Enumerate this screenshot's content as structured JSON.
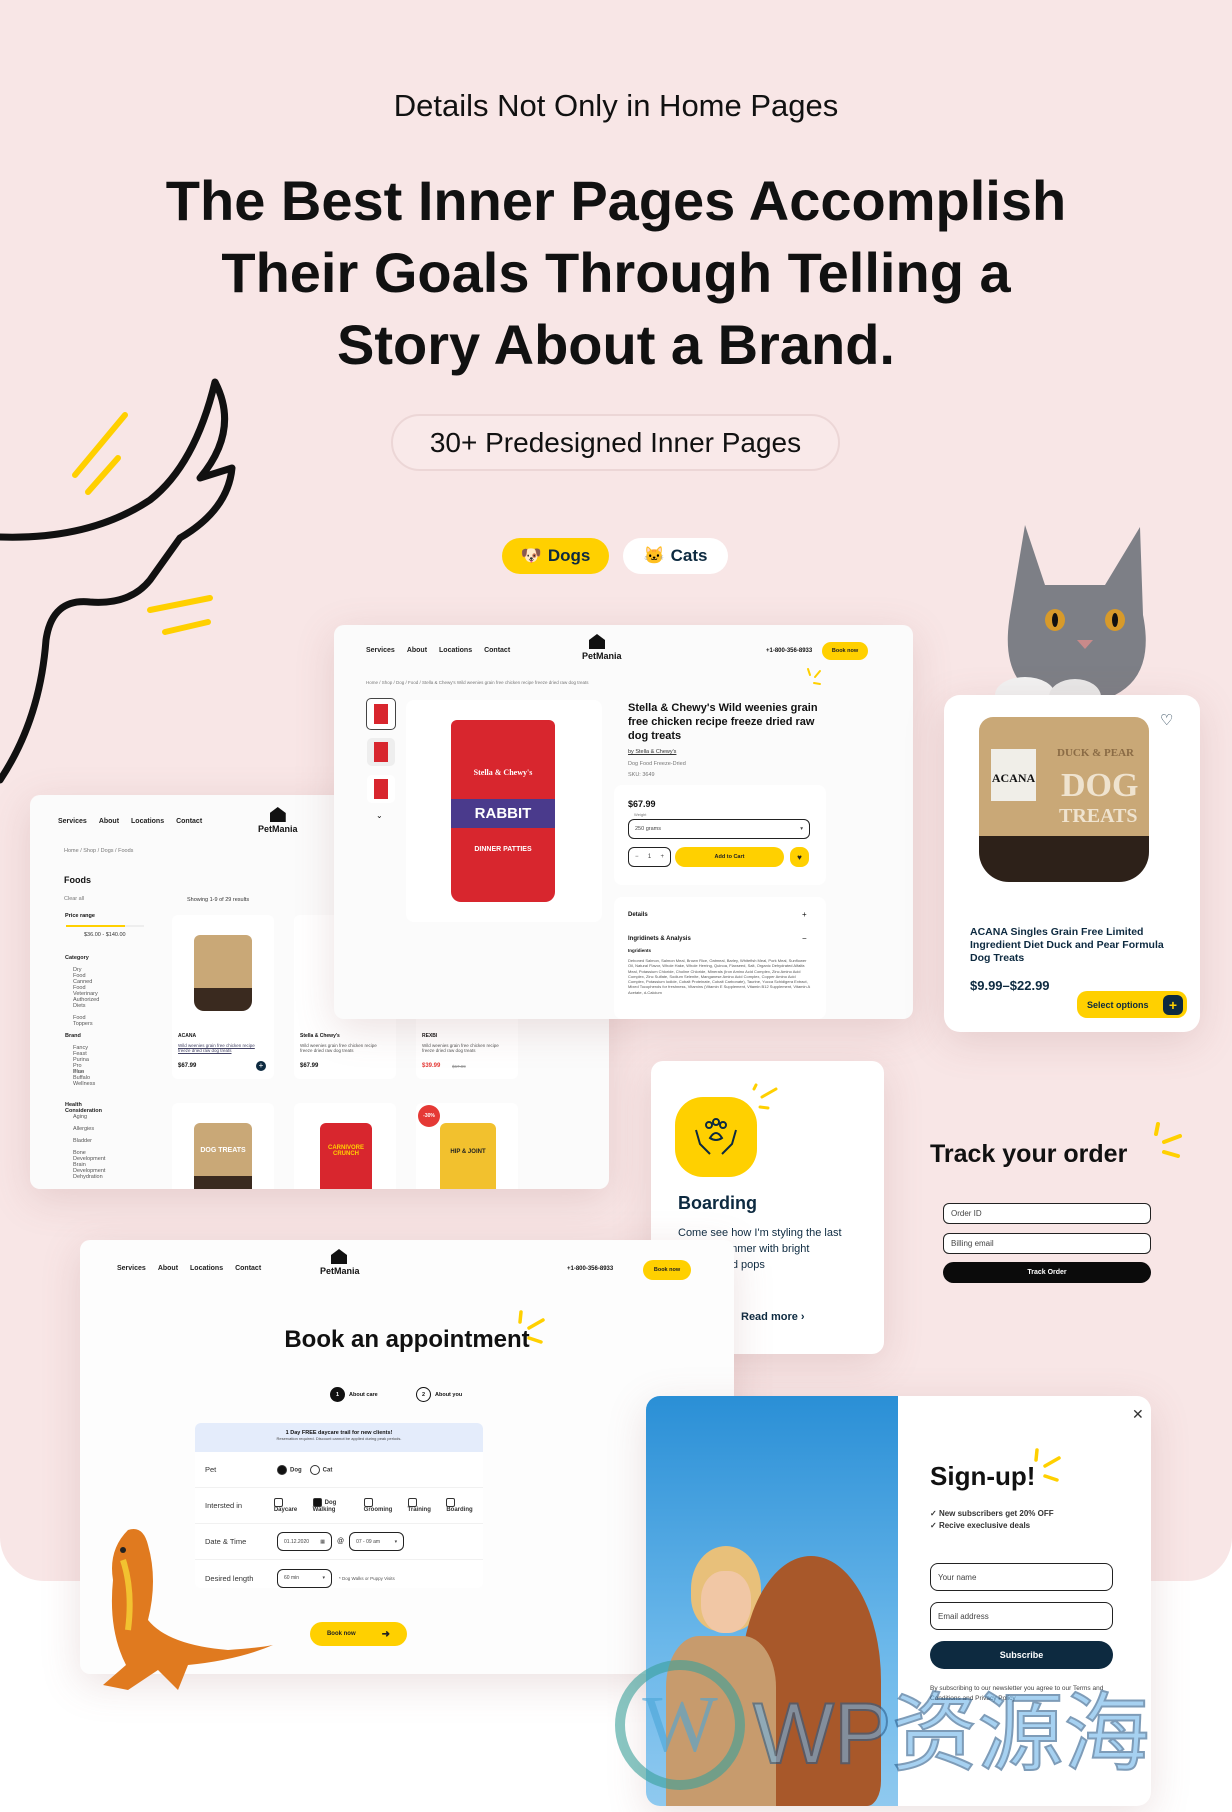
{
  "hero": {
    "subtitle": "Details Not Only in Home Pages",
    "headline_lines": [
      "The Best Inner Pages Accomplish",
      "Their Goals Through Telling a",
      "Story About a Brand."
    ],
    "pill": "30+ Predesigned Inner Pages",
    "tabs": [
      {
        "label": "Dogs",
        "emoji": "🐶",
        "active": true
      },
      {
        "label": "Cats",
        "emoji": "🐱",
        "active": false
      }
    ]
  },
  "colors": {
    "background": "#f8e6e6",
    "accent": "#ffd000",
    "navy": "#0d2a40",
    "sale": "#e53935"
  },
  "nav": {
    "services": "Services",
    "about": "About",
    "locations": "Locations",
    "contact": "Contact",
    "brand": "PetMania",
    "phone": "+1-800-356-8933",
    "book_now": "Book now"
  },
  "product_page": {
    "breadcrumb": "Home / Shop / Dog / Food / Stella & Chewy's Wild weenies grain free chicken recipe freeze dried raw dog treats",
    "title": "Stella & Chewy's Wild weenies grain free chicken recipe freeze dried raw dog treats",
    "by": "by Stella & Chewy's",
    "category": "Dog Food Freeze-Dried",
    "sku": "SKU: 3649",
    "price": "$67.99",
    "weight_label": "Weight",
    "weight_value": "250 grams",
    "qty": "1",
    "add_to_cart": "Add to Cart",
    "details": "Details",
    "ingredients_analysis": "Ingridinets & Analysis",
    "ingredients": "Ingridients",
    "ingredients_text": "Deboned Salmon, Salmon Meal, Brown Rice, Oatmeal, Barley, Whitefish Meal, Pork Meal, Sunflower Oil, Natural Flavor, Whole Hake, Whole Herring, Quinoa, Flaxseed, Salt, Organic Dehydrated Alfalfa Meal, Potassium Chloride, Choline Chloride, Minerals (Iron Amino Acid Complex, Zinc Amino Acid Complex, Zinc Sulfate, Sodium Selenite, Manganese Amino Acid Complex, Copper Amino Acid Complex, Potassium Iodide, Cobalt Proteinate, Cobalt Carbonate), Taurine, Yucca Schidigera Extract, Mixed Tocopherols for freshness, Vitamins (Vitamin E Supplement, Vitamin B12 Supplement, Vitamin A Acetate, d-Calcium",
    "bag_brand": "Stella & Chewy's",
    "bag_name": "RABBIT",
    "bag_sub": "DINNER PATTIES"
  },
  "shop_page": {
    "breadcrumb": "Home / Shop / Dogs / Foods",
    "title": "Foods",
    "clear_all": "Clear all",
    "price_range_label": "Price range",
    "price_range_value": "$36.00 - $140.00",
    "price_range_fraction": [
      0,
      0.75
    ],
    "showing": "Showing 1-9 of 29 results",
    "filters": [
      {
        "title": "Category",
        "items": [
          "Dry Food",
          "Canned Food",
          "Veterinary Authorized",
          "Diets",
          "Food Toppers"
        ]
      },
      {
        "title": "Brand",
        "items": [
          "Fancy Feast",
          "Purina Pro Plan",
          "Blue Buffalo",
          "Wellness"
        ]
      },
      {
        "title": "Health Consideration",
        "items": [
          "Aging",
          "Allergies",
          "Bladder",
          "Bone Development",
          "Brain Development",
          "Dehydration"
        ]
      }
    ],
    "products": [
      {
        "brand": "ACANA",
        "name": "Wild weenies grain free chicken recipe freeze dried raw dog treats",
        "price": "$67.99",
        "old_price": ""
      },
      {
        "brand": "Stella & Chewy's",
        "name": "Wild weenies grain free chicken recipe freeze dried raw dog treats",
        "price": "$67.99",
        "old_price": ""
      },
      {
        "brand": "REXBI",
        "name": "Wild weenies grain free chicken recipe freeze dried raw dog treats",
        "price": "$39.99",
        "old_price": "$67.99"
      }
    ],
    "row2": [
      {
        "label": "DOG TREATS"
      },
      {
        "label": "CARNIVORE CRUNCH"
      },
      {
        "label": "HIP & JOINT",
        "badge": "-30%"
      }
    ]
  },
  "acana_card": {
    "title": "ACANA Singles Grain Free Limited Ingredient Diet Duck and Pear Formula Dog Treats",
    "price": "$9.99–$22.99",
    "select_options": "Select options",
    "bag_brand": "ACANA",
    "bag_line": "DUCK & PEAR",
    "bag_big": "DOG",
    "bag_big2": "TREATS"
  },
  "boarding": {
    "title": "Boarding",
    "text": "Come see how I'm styling the last days of summer with bright palettes and pops",
    "link": "Read more ›"
  },
  "track": {
    "title": "Track your order",
    "order_id": "Order ID",
    "billing_email": "Billing email",
    "button": "Track Order"
  },
  "booking": {
    "title": "Book an appointment",
    "steps": [
      {
        "num": "1",
        "label": "About care",
        "active": true
      },
      {
        "num": "2",
        "label": "About you",
        "active": false
      }
    ],
    "banner_title": "1 Day FREE daycare trail for new clients!",
    "banner_sub": "Reservation required. Discount cannot be applied during peak periods.",
    "pet_label": "Pet",
    "pets": [
      {
        "label": "Dog",
        "checked": true
      },
      {
        "label": "Cat",
        "checked": false
      }
    ],
    "interest_label": "Intersted in",
    "interests": [
      {
        "label": "Daycare",
        "checked": false
      },
      {
        "label": "Dog Walking",
        "checked": true
      },
      {
        "label": "Grooming",
        "checked": false
      },
      {
        "label": "Training",
        "checked": false
      },
      {
        "label": "Boarding",
        "checked": false
      }
    ],
    "datetime_label": "Date & Time",
    "date": "01.12.2020",
    "at": "@",
    "time": "07 - 09 am",
    "length_label": "Desired length",
    "length": "60 min",
    "length_note": "* Dog Walks or Puppy Visits",
    "submit": "Book now"
  },
  "signup": {
    "title": "Sign-up!",
    "benefits": [
      "New subscribers get 20% OFF",
      "Recive execlusive deals"
    ],
    "name_placeholder": "Your name",
    "email_placeholder": "Email address",
    "subscribe": "Subscribe",
    "fine_print": "By subscribing to our newsletter you agree to our Terms and Conditions and Privacy Policy"
  },
  "watermark": "WP资源海"
}
